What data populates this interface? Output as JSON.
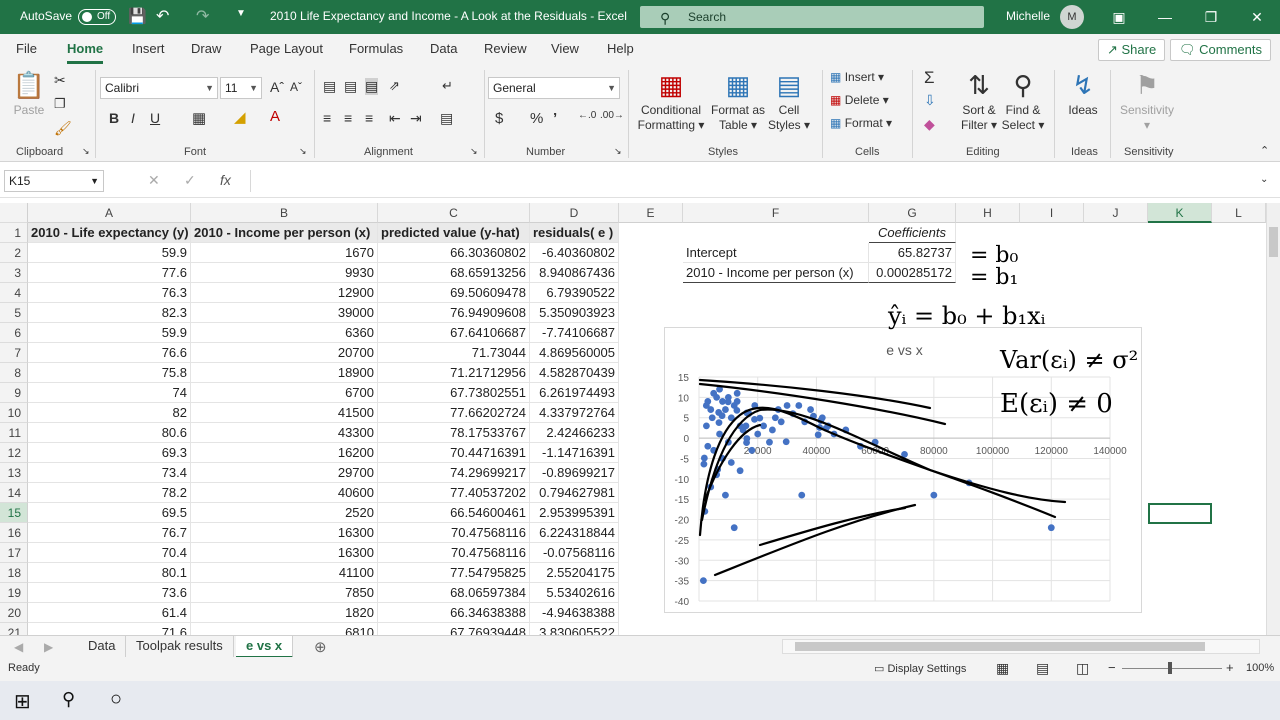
{
  "titlebar": {
    "autosave_label": "AutoSave",
    "autosave_state": "Off",
    "doc_title": "2010 Life Expectancy and Income - A Look at the Residuals  -  Excel",
    "search_placeholder": "Search",
    "user_name": "Michelle",
    "user_initial": "M"
  },
  "ribbon_tabs": [
    "File",
    "Home",
    "Insert",
    "Draw",
    "Page Layout",
    "Formulas",
    "Data",
    "Review",
    "View",
    "Help"
  ],
  "ribbon_active_tab": "Home",
  "share_label": "Share",
  "comments_label": "Comments",
  "ribbon": {
    "paste": "Paste",
    "font_name": "Calibri",
    "font_size": "11",
    "number_format": "General",
    "conditional_formatting": [
      "Conditional",
      "Formatting"
    ],
    "format_as_table": [
      "Format as",
      "Table"
    ],
    "cell_styles": [
      "Cell",
      "Styles"
    ],
    "insert": "Insert",
    "delete": "Delete",
    "format": "Format",
    "sort_filter": [
      "Sort &",
      "Filter"
    ],
    "find_select": [
      "Find &",
      "Select"
    ],
    "ideas": "Ideas",
    "sensitivity": "Sensitivity",
    "groups": [
      "Clipboard",
      "Font",
      "Alignment",
      "Number",
      "Styles",
      "Cells",
      "Editing",
      "Ideas",
      "Sensitivity"
    ]
  },
  "formula_bar": {
    "name_box": "K15",
    "fx": "fx",
    "value": ""
  },
  "columns": [
    "A",
    "B",
    "C",
    "D",
    "E",
    "F",
    "G",
    "H",
    "I",
    "J",
    "K",
    "L"
  ],
  "selected_column": "K",
  "selected_row": "15",
  "headers_row": [
    "2010 - Life expectancy (y)",
    "2010 - Income per person (x)",
    "predicted value (y-hat)",
    "residuals( e )"
  ],
  "rows": [
    {
      "n": "2",
      "a": "59.9",
      "b": "1670",
      "c": "66.30360802",
      "d": "-6.40360802"
    },
    {
      "n": "3",
      "a": "77.6",
      "b": "9930",
      "c": "68.65913256",
      "d": "8.940867436"
    },
    {
      "n": "4",
      "a": "76.3",
      "b": "12900",
      "c": "69.50609478",
      "d": "6.79390522"
    },
    {
      "n": "5",
      "a": "82.3",
      "b": "39000",
      "c": "76.94909608",
      "d": "5.350903923"
    },
    {
      "n": "6",
      "a": "59.9",
      "b": "6360",
      "c": "67.64106687",
      "d": "-7.74106687"
    },
    {
      "n": "7",
      "a": "76.6",
      "b": "20700",
      "c": "71.73044",
      "d": "4.869560005"
    },
    {
      "n": "8",
      "a": "75.8",
      "b": "18900",
      "c": "71.21712956",
      "d": "4.582870439"
    },
    {
      "n": "9",
      "a": "74",
      "b": "6700",
      "c": "67.73802551",
      "d": "6.261974493"
    },
    {
      "n": "10",
      "a": "82",
      "b": "41500",
      "c": "77.66202724",
      "d": "4.337972764"
    },
    {
      "n": "11",
      "a": "80.6",
      "b": "43300",
      "c": "78.17533767",
      "d": "2.42466233"
    },
    {
      "n": "12",
      "a": "69.3",
      "b": "16200",
      "c": "70.44716391",
      "d": "-1.14716391"
    },
    {
      "n": "13",
      "a": "73.4",
      "b": "29700",
      "c": "74.29699217",
      "d": "-0.89699217"
    },
    {
      "n": "14",
      "a": "78.2",
      "b": "40600",
      "c": "77.40537202",
      "d": "0.794627981"
    },
    {
      "n": "15",
      "a": "69.5",
      "b": "2520",
      "c": "66.54600461",
      "d": "2.953995391"
    },
    {
      "n": "16",
      "a": "76.7",
      "b": "16300",
      "c": "70.47568116",
      "d": "6.224318844"
    },
    {
      "n": "17",
      "a": "70.4",
      "b": "16300",
      "c": "70.47568116",
      "d": "-0.07568116"
    },
    {
      "n": "18",
      "a": "80.1",
      "b": "41100",
      "c": "77.54795825",
      "d": "2.55204175"
    },
    {
      "n": "19",
      "a": "73.6",
      "b": "7850",
      "c": "68.06597384",
      "d": "5.53402616"
    },
    {
      "n": "20",
      "a": "61.4",
      "b": "1820",
      "c": "66.34638388",
      "d": "-4.94638388"
    },
    {
      "n": "21",
      "a": "71.6",
      "b": "6810",
      "c": "67.76939448",
      "d": "3.830605522"
    }
  ],
  "regression": {
    "coefficients_header": "Coefficients",
    "intercept_label": "Intercept",
    "intercept_value": "65.82737",
    "slope_label": "2010 - Income per person (x)",
    "slope_value": "0.000285172"
  },
  "chart_data": {
    "type": "scatter",
    "title": "e vs x",
    "xlim": [
      0,
      140000
    ],
    "ylim": [
      -40,
      15
    ],
    "x_ticks": [
      20000,
      40000,
      60000,
      80000,
      100000,
      120000,
      140000
    ],
    "y_ticks": [
      15,
      10,
      5,
      0,
      -5,
      -10,
      -15,
      -20,
      -25,
      -30,
      -35,
      -40
    ],
    "grid": true,
    "point_color": "#4472c4",
    "series": [
      {
        "points": [
          [
            1670,
            -6.4
          ],
          [
            9930,
            8.9
          ],
          [
            12900,
            6.8
          ],
          [
            39000,
            5.4
          ],
          [
            6360,
            -7.7
          ],
          [
            20700,
            4.9
          ],
          [
            18900,
            4.6
          ],
          [
            6700,
            6.3
          ],
          [
            41500,
            4.3
          ],
          [
            43300,
            2.4
          ],
          [
            16200,
            -1.1
          ],
          [
            29700,
            -0.9
          ],
          [
            40600,
            0.8
          ],
          [
            2520,
            3.0
          ],
          [
            16300,
            6.2
          ],
          [
            16300,
            -0.1
          ],
          [
            41100,
            2.6
          ],
          [
            7850,
            5.5
          ],
          [
            1820,
            -4.9
          ],
          [
            6810,
            3.8
          ],
          [
            3000,
            9
          ],
          [
            4000,
            7
          ],
          [
            5000,
            11
          ],
          [
            6000,
            10
          ],
          [
            7000,
            12
          ],
          [
            8000,
            9
          ],
          [
            9000,
            7
          ],
          [
            10000,
            10
          ],
          [
            11000,
            5
          ],
          [
            12000,
            8
          ],
          [
            13000,
            9
          ],
          [
            14000,
            3
          ],
          [
            15000,
            2
          ],
          [
            17000,
            6
          ],
          [
            19000,
            8
          ],
          [
            22000,
            3
          ],
          [
            25000,
            2
          ],
          [
            27000,
            7
          ],
          [
            30000,
            8
          ],
          [
            32000,
            6
          ],
          [
            34000,
            8
          ],
          [
            36000,
            4
          ],
          [
            38000,
            7
          ],
          [
            42000,
            5
          ],
          [
            44000,
            3
          ],
          [
            46000,
            1
          ],
          [
            50000,
            2
          ],
          [
            55000,
            -2
          ],
          [
            60000,
            -1
          ],
          [
            70000,
            -4
          ],
          [
            80000,
            -14
          ],
          [
            92000,
            -11
          ],
          [
            120000,
            -22
          ],
          [
            35000,
            -14
          ],
          [
            12000,
            -22
          ],
          [
            2000,
            -18
          ],
          [
            1500,
            -35
          ],
          [
            4000,
            -12
          ],
          [
            6000,
            -9
          ],
          [
            3000,
            -2
          ],
          [
            5000,
            -3
          ],
          [
            8000,
            -5
          ],
          [
            10000,
            -1
          ],
          [
            14000,
            -8
          ],
          [
            18000,
            -3
          ],
          [
            20000,
            1
          ],
          [
            24000,
            -1
          ],
          [
            9000,
            -14
          ],
          [
            11000,
            -6
          ],
          [
            7000,
            1
          ],
          [
            16000,
            3
          ],
          [
            4500,
            5
          ],
          [
            2500,
            8
          ],
          [
            13000,
            11
          ],
          [
            26000,
            5
          ],
          [
            28000,
            4
          ]
        ]
      }
    ]
  },
  "handwriting": {
    "b0": "= b₀",
    "b1": "= b₁",
    "regression_eq": "ŷᵢ = b₀ + b₁xᵢ",
    "var_note": "Var(εᵢ) ≠ σ²",
    "exp_note": "E(εᵢ) ≠ 0"
  },
  "sheet_tabs": [
    "Data",
    "Toolpak results",
    "e vs x"
  ],
  "active_sheet": "e vs x",
  "status": {
    "ready": "Ready",
    "display_settings": "Display Settings",
    "zoom": "100%"
  }
}
